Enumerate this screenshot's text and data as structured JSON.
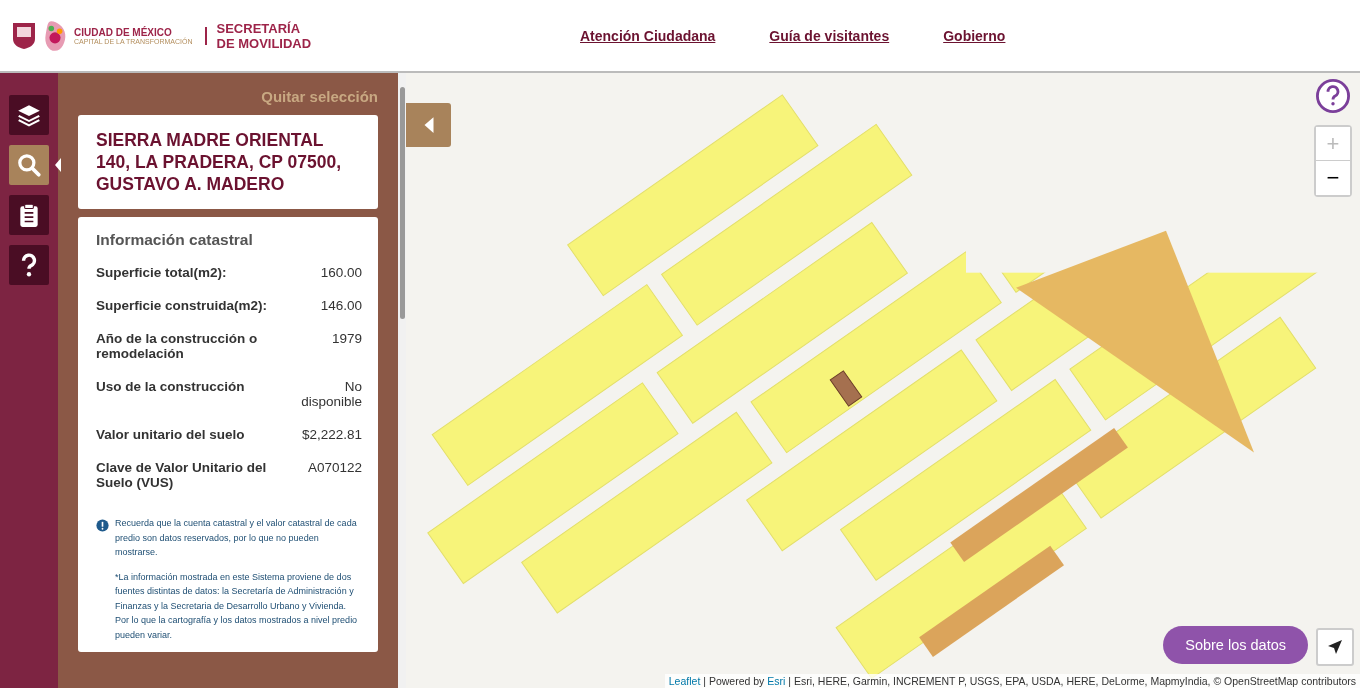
{
  "header": {
    "city": "CIUDAD DE MÉXICO",
    "city_motto": "CAPITAL DE LA TRANSFORMACIÓN",
    "agency_line_1": "SECRETARÍA",
    "agency_line_2": "DE MOVILIDAD",
    "nav": [
      "Atención Ciudadana",
      "Guía de visitantes",
      "Gobierno"
    ]
  },
  "rail": [
    {
      "kind": "layers",
      "selected": false
    },
    {
      "kind": "search",
      "selected": true
    },
    {
      "kind": "clipboard",
      "selected": false
    },
    {
      "kind": "help",
      "selected": false
    }
  ],
  "panel": {
    "clear_selection": "Quitar selección",
    "address": "SIERRA MADRE ORIENTAL 140, LA PRADERA, CP 07500, GUSTAVO A. MADERO",
    "info_title": "Información catastral",
    "rows": [
      {
        "label": "Superficie total(m2):",
        "value": "160.00"
      },
      {
        "label": "Superficie construida(m2):",
        "value": "146.00"
      },
      {
        "label": "Año de la construcción o remodelación",
        "value": "1979"
      },
      {
        "label": "Uso de la construcción",
        "value": "No disponible"
      },
      {
        "label": "Valor unitario del suelo",
        "value": "$2,222.81"
      },
      {
        "label": "Clave de Valor Unitario del Suelo (VUS)",
        "value": "A070122"
      }
    ],
    "notice": "Recuerda que la cuenta catastral y el valor catastral de cada predio son datos reservados, por lo que no pueden mostrarse.",
    "disclaimer": "*La información mostrada en este Sistema proviene de dos fuentes distintas de datos: la Secretaría de Administración y Finanzas y la Secretaria de Desarrollo Urbano y Vivienda. Por lo que la cartografía y los datos mostrados a nivel predio pueden variar."
  },
  "map": {
    "zoom_in": "+",
    "zoom_out": "−",
    "about_button": "Sobre los datos",
    "attribution": {
      "leaflet": "Leaflet",
      "powered_by": "| Powered by",
      "esri": "Esri",
      "sources": "| Esri, HERE, Garmin, INCREMENT P, USGS, EPA, USDA, HERE, DeLorme, MapmyIndia, © OpenStreetMap contributors"
    }
  }
}
